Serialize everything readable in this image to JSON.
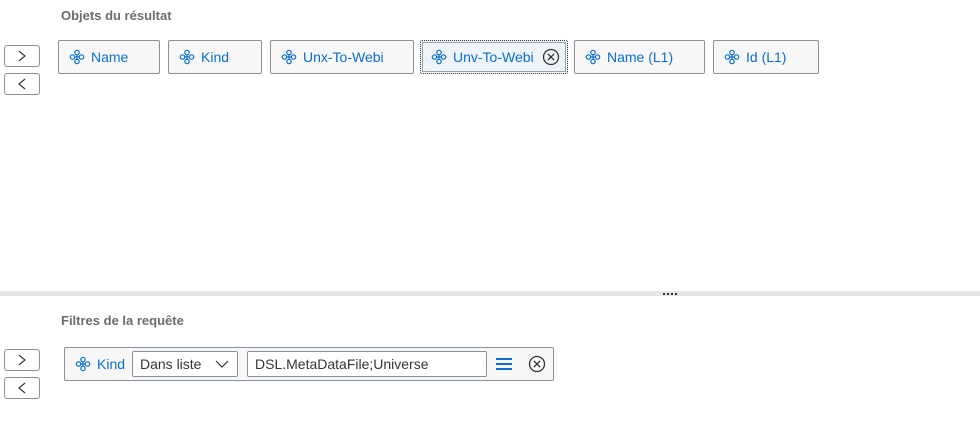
{
  "result_section": {
    "title": "Objets du résultat",
    "chips": [
      {
        "label": "Name"
      },
      {
        "label": "Kind"
      },
      {
        "label": "Unx-To-Webi"
      },
      {
        "label": "Unv-To-Webi",
        "selected": true
      },
      {
        "label": "Name (L1)"
      },
      {
        "label": "Id (L1)"
      }
    ]
  },
  "filter_section": {
    "title": "Filtres de la requête",
    "filter": {
      "object": "Kind",
      "operator": "Dans liste",
      "value": "DSL.MetaDataFile;Universe"
    }
  },
  "icons": {
    "object": "dimension-icon",
    "remove": "remove-circle-icon",
    "list": "list-icon",
    "move_right": "chevron-right-icon",
    "move_left": "chevron-left-icon"
  },
  "colors": {
    "accent": "#0a6ed1",
    "text": "#32363a",
    "title": "#6a6d70",
    "border": "#89919a"
  }
}
